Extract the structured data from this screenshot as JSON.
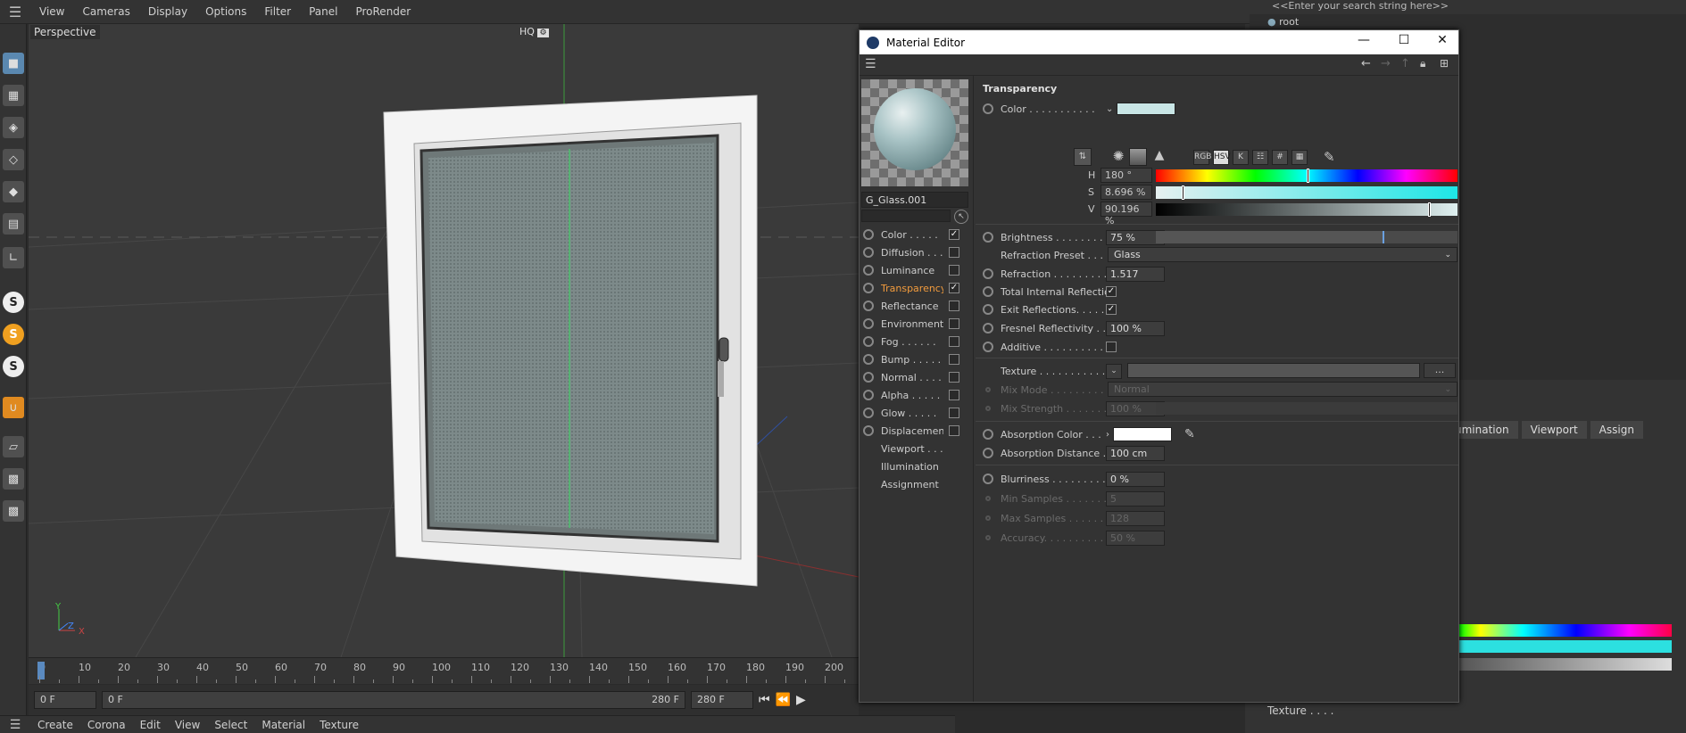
{
  "menubar": {
    "items": [
      "View",
      "Cameras",
      "Display",
      "Options",
      "Filter",
      "Panel",
      "ProRender"
    ]
  },
  "viewport": {
    "label": "Perspective",
    "hq": "HQ"
  },
  "timeline": {
    "ticks": [
      "0",
      "10",
      "20",
      "30",
      "40",
      "50",
      "60",
      "70",
      "80",
      "90",
      "100",
      "110",
      "120",
      "130",
      "140",
      "150",
      "160",
      "170",
      "180",
      "190",
      "200"
    ],
    "start_field": "0 F",
    "current_field": "0 F",
    "end_inner": "280 F",
    "end_field": "280 F"
  },
  "bottom_menu": {
    "items": [
      "Create",
      "Corona",
      "Edit",
      "View",
      "Select",
      "Material",
      "Texture"
    ]
  },
  "right_panel": {
    "search_placeholder": "<<Enter your search string here>>",
    "root_label": "root",
    "tabs": [
      "umination",
      "Viewport",
      "Assign"
    ],
    "texture_label": "Texture . . . ."
  },
  "material_editor": {
    "title": "Material Editor",
    "material_name": "G_Glass.001",
    "channels": [
      {
        "label": "Color . . . . .",
        "checked": true
      },
      {
        "label": "Diffusion . . .",
        "checked": false
      },
      {
        "label": "Luminance",
        "checked": false
      },
      {
        "label": "Transparency",
        "checked": true,
        "active": true
      },
      {
        "label": "Reflectance",
        "checked": false
      },
      {
        "label": "Environment",
        "checked": false
      },
      {
        "label": "Fog . . . . . .",
        "checked": false
      },
      {
        "label": "Bump . . . . .",
        "checked": false
      },
      {
        "label": "Normal . . . .",
        "checked": false
      },
      {
        "label": "Alpha . . . . .",
        "checked": false
      },
      {
        "label": "Glow . . . . .",
        "checked": false
      },
      {
        "label": "Displacement",
        "checked": false
      }
    ],
    "extra_items": [
      "Viewport . . .",
      "Illumination",
      "Assignment"
    ],
    "section_title": "Transparency",
    "color_label": "Color . . . . . . . . . . .",
    "color_swatch": "#c9e6e6",
    "color_modes": [
      "RGB",
      "HSV",
      "K"
    ],
    "hsv": {
      "h_label": "H",
      "h_value": "180 °",
      "h_fraction": 0.5,
      "s_label": "S",
      "s_value": "8.696 %",
      "s_fraction": 0.087,
      "v_label": "V",
      "v_value": "90.196 %",
      "v_fraction": 0.902
    },
    "brightness": {
      "label": "Brightness . . . . . . . . .",
      "value": "75 %",
      "fraction": 0.75
    },
    "refraction_preset": {
      "label": "Refraction Preset . . .",
      "value": "Glass"
    },
    "refraction": {
      "label": "Refraction . . . . . . . . .",
      "value": "1.517"
    },
    "total_internal_reflection": {
      "label": "Total Internal Reflection",
      "checked": true
    },
    "exit_reflections": {
      "label": "Exit Reflections. . . . . .",
      "checked": true
    },
    "fresnel": {
      "label": "Fresnel Reflectivity . . .",
      "value": "100 %"
    },
    "additive": {
      "label": "Additive . . . . . . . . . . .",
      "checked": false
    },
    "texture": {
      "label": "Texture . . . . . . . . . . .",
      "button": "..."
    },
    "mix_mode": {
      "label": "Mix Mode . . . . . . . . .",
      "value": "Normal"
    },
    "mix_strength": {
      "label": "Mix Strength . . . . . . .",
      "value": "100 %"
    },
    "absorption_color": {
      "label": "Absorption Color . . .",
      "swatch": "#ffffff"
    },
    "absorption_distance": {
      "label": "Absorption Distance . .",
      "value": "100 cm"
    },
    "blurriness": {
      "label": "Blurriness . . . . . . . . .",
      "value": "0 %"
    },
    "min_samples": {
      "label": "Min Samples . . . . . . .",
      "value": "5"
    },
    "max_samples": {
      "label": "Max Samples . . . . . . .",
      "value": "128"
    },
    "accuracy": {
      "label": "Accuracy. . . . . . . . . . .",
      "value": "50 %"
    }
  }
}
